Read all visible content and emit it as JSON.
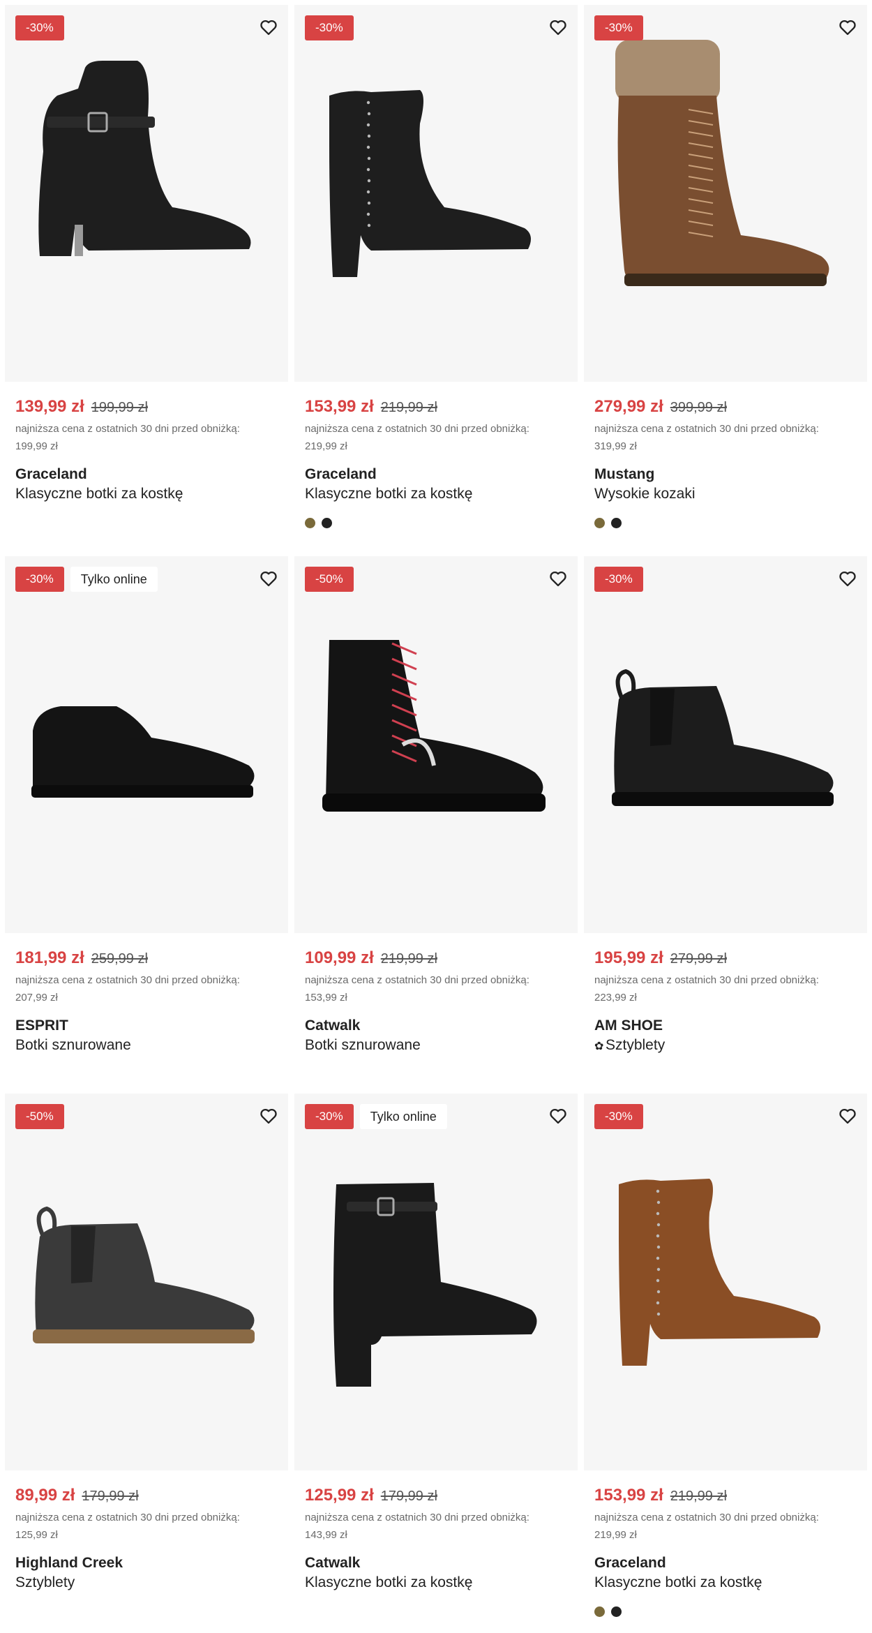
{
  "labels": {
    "lowest_price": "najniższa cena z ostatnich 30 dni przed obniżką:",
    "online_only": "Tylko online"
  },
  "colors": {
    "accent": "#d84343",
    "swatch_olive": "#7a6a3a",
    "swatch_black": "#222222"
  },
  "products": [
    {
      "discount": "-30%",
      "online_only": false,
      "price": "139,99 zł",
      "old_price": "199,99 zł",
      "lowest_price": "199,99 zł",
      "brand": "Graceland",
      "name": "Klasyczne botki za kostkę",
      "eco_icon": false,
      "swatches": [],
      "shoe": "ankle-buckle-heel",
      "color": "#1e1e1e"
    },
    {
      "discount": "-30%",
      "online_only": false,
      "price": "153,99 zł",
      "old_price": "219,99 zł",
      "lowest_price": "219,99 zł",
      "brand": "Graceland",
      "name": "Klasyczne botki za kostkę",
      "eco_icon": false,
      "swatches": [
        "#7a6a3a",
        "#222222"
      ],
      "shoe": "ankle-studded-heel",
      "color": "#1e1e1e"
    },
    {
      "discount": "-30%",
      "online_only": false,
      "price": "279,99 zł",
      "old_price": "399,99 zł",
      "lowest_price": "319,99 zł",
      "brand": "Mustang",
      "name": "Wysokie kozaki",
      "eco_icon": false,
      "swatches": [
        "#7a6a3a",
        "#222222"
      ],
      "shoe": "tall-lace-boot",
      "color": "#7a4e30"
    },
    {
      "discount": "-30%",
      "online_only": true,
      "price": "181,99 zł",
      "old_price": "259,99 zł",
      "lowest_price": "207,99 zł",
      "brand": "ESPRIT",
      "name": "Botki sznurowane",
      "eco_icon": false,
      "swatches": [],
      "shoe": "chukka",
      "color": "#141414"
    },
    {
      "discount": "-50%",
      "online_only": false,
      "price": "109,99 zł",
      "old_price": "219,99 zł",
      "lowest_price": "153,99 zł",
      "brand": "Catwalk",
      "name": "Botki sznurowane",
      "eco_icon": false,
      "swatches": [],
      "shoe": "combat-boot",
      "color": "#141414"
    },
    {
      "discount": "-30%",
      "online_only": false,
      "price": "195,99 zł",
      "old_price": "279,99 zł",
      "lowest_price": "223,99 zł",
      "brand": "AM SHOE",
      "name": "Sztyblety",
      "eco_icon": true,
      "swatches": [],
      "shoe": "chelsea",
      "color": "#1c1c1c"
    },
    {
      "discount": "-50%",
      "online_only": false,
      "price": "89,99 zł",
      "old_price": "179,99 zł",
      "lowest_price": "125,99 zł",
      "brand": "Highland Creek",
      "name": "Sztyblety",
      "eco_icon": false,
      "swatches": [],
      "shoe": "chelsea-grey",
      "color": "#3a3a3a"
    },
    {
      "discount": "-30%",
      "online_only": true,
      "price": "125,99 zł",
      "old_price": "179,99 zł",
      "lowest_price": "143,99 zł",
      "brand": "Catwalk",
      "name": "Klasyczne botki za kostkę",
      "eco_icon": false,
      "swatches": [],
      "shoe": "ankle-block-heel",
      "color": "#1a1a1a"
    },
    {
      "discount": "-30%",
      "online_only": false,
      "price": "153,99 zł",
      "old_price": "219,99 zł",
      "lowest_price": "219,99 zł",
      "brand": "Graceland",
      "name": "Klasyczne botki za kostkę",
      "eco_icon": false,
      "swatches": [
        "#7a6a3a",
        "#222222"
      ],
      "shoe": "ankle-studded-heel",
      "color": "#8a4e25"
    }
  ]
}
